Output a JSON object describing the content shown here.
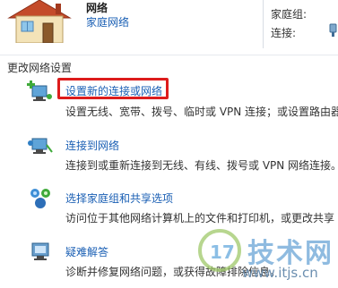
{
  "network": {
    "name": "网络",
    "type": "家庭网络",
    "homegroup_label": "家庭组:",
    "connection_label": "连接:"
  },
  "section": {
    "title": "更改网络设置"
  },
  "tasks": [
    {
      "link": "设置新的连接或网络",
      "desc": "设置无线、宽带、拨号、临时或 VPN 连接；或设置路由器"
    },
    {
      "link": "连接到网络",
      "desc": "连接到或重新连接到无线、有线、拨号或 VPN 网络连接。"
    },
    {
      "link": "选择家庭组和共享选项",
      "desc": "访问位于其他网络计算机上的文件和打印机，或更改共享"
    },
    {
      "link": "疑难解答",
      "desc": "诊断并修复网络问题，或获得故障排除信息。"
    }
  ],
  "watermark": {
    "brand": "技术网",
    "url": "www.itjs.cn"
  },
  "colors": {
    "link": "#1a5fb4",
    "highlight": "#dd1c1c",
    "watermark": "#8fbbe0"
  },
  "icons": {
    "network": "house-icon",
    "connection": "ethernet-plug-icon",
    "task1": "new-connection-icon",
    "task2": "connect-network-icon",
    "task3": "homegroup-icon",
    "task4": "troubleshoot-icon"
  }
}
